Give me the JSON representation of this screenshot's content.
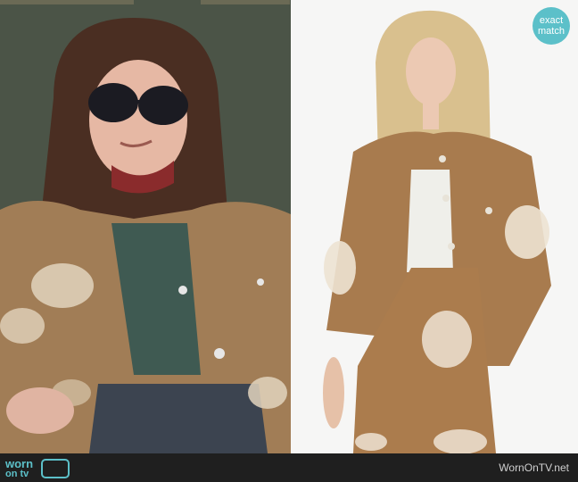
{
  "match_badge": {
    "line1": "exact",
    "line2": "match"
  },
  "footer": {
    "logo": {
      "line1": "worn",
      "line2": "on tv"
    },
    "site_name": "WornOnTV.net"
  },
  "colors": {
    "accent": "#5cc0c9",
    "footer_bg": "#1f1f1f"
  }
}
